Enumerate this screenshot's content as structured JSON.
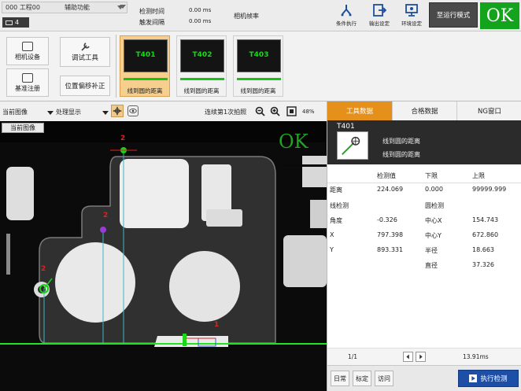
{
  "top": {
    "scene_select": "000 工程00",
    "aux_menu": "辅助功能",
    "scene_tab": "4",
    "detect_time_label": "检测时间",
    "detect_time_value": "0.00 ms",
    "trigger_interval_label": "触发间隔",
    "trigger_interval_value": "0.00 ms",
    "camera_fps_label": "相机帧率",
    "buttons": [
      {
        "label": "条件执行",
        "icon": "condition-icon"
      },
      {
        "label": "输出设定",
        "icon": "output-icon"
      },
      {
        "label": "环境设定",
        "icon": "monitor-icon"
      }
    ],
    "run_mode": "至运行模式",
    "result": "OK"
  },
  "toolbar": {
    "camera_settings": "相机设备",
    "reference_register": "基准注册",
    "debug_tool": "调试工具",
    "position_compensation": "位置偏移补正",
    "tools": [
      {
        "id": "T401",
        "label": "线到圆的距离",
        "selected": true
      },
      {
        "id": "T402",
        "label": "线到圆的距离",
        "selected": false
      },
      {
        "id": "T403",
        "label": "线到圆的距离",
        "selected": false
      }
    ]
  },
  "view": {
    "current_image": "当前图像",
    "process_display": "处理显示",
    "continuous_capture": "连续第1次拍照",
    "zoom_percent": "48%",
    "image_label": "当前图像",
    "overlay_result": "OK",
    "marker_labels": [
      "2",
      "2",
      "2",
      "1"
    ]
  },
  "rpanel": {
    "tabs": [
      "工具数据",
      "合格数据",
      "NG窗口"
    ],
    "tool_id": "T401",
    "tool_name": "线到圆的距离",
    "tool_subname": "线到圆的距离",
    "table_headers": [
      "检测值",
      "下限",
      "上限"
    ],
    "rows": [
      {
        "name": "距离",
        "value": "224.069",
        "lower": "0.000",
        "upper": "99999.999"
      },
      {
        "name": "线检测",
        "value": "",
        "lower": "圆检测",
        "upper": ""
      },
      {
        "name": "角度",
        "value": "-0.326",
        "lower": "中心X",
        "upper": "154.743"
      },
      {
        "name": "X",
        "value": "797.398",
        "lower": "中心Y",
        "upper": "672.860"
      },
      {
        "name": "Y",
        "value": "893.331",
        "lower": "半径",
        "upper": "18.663"
      },
      {
        "name": "",
        "value": "",
        "lower": "直径",
        "upper": "37.326"
      }
    ],
    "page": "1/1",
    "elapsed": "13.91ms",
    "bottom_buttons": [
      "日常",
      "标定",
      "访问"
    ],
    "execute_button": "执行检测"
  }
}
